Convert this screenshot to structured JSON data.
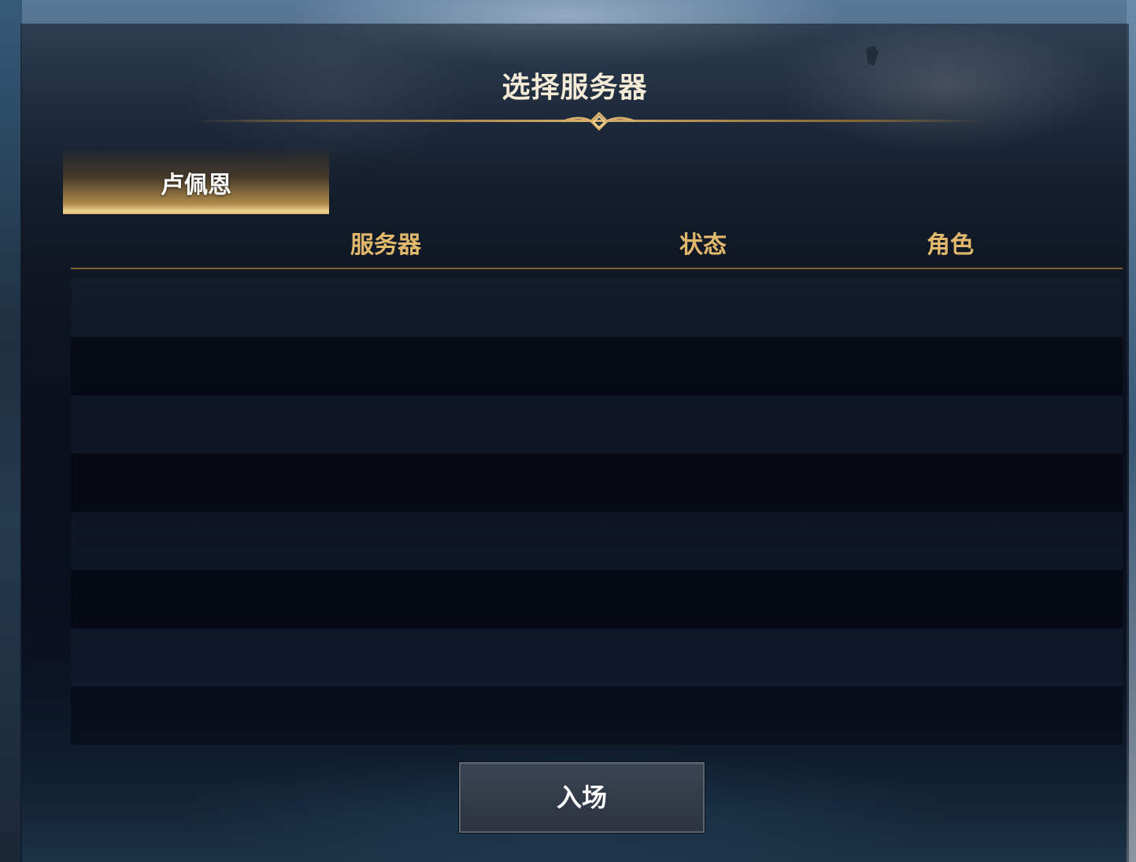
{
  "dialog": {
    "title": "选择服务器"
  },
  "tabs": [
    {
      "label": "卢佩恩",
      "active": true
    }
  ],
  "table": {
    "columns": [
      "服务器",
      "状态",
      "角色"
    ],
    "rows": []
  },
  "enter_button": {
    "label": "入场"
  },
  "colors": {
    "accent_gold": "#e2b96c",
    "title_text": "#f4ead6",
    "button_bg": "#2f3844"
  }
}
